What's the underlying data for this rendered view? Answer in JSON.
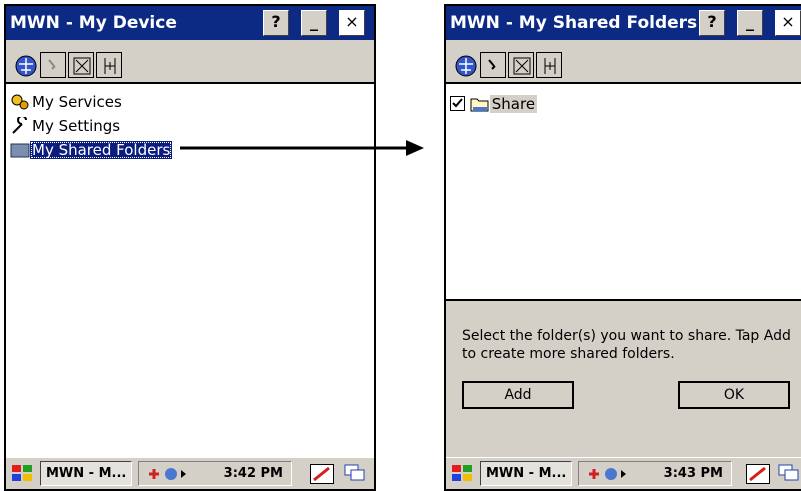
{
  "left_window": {
    "title": "MWN - My Device",
    "help_label": "?",
    "minimize_label": "_",
    "close_label": "×",
    "items": [
      {
        "label": "My Services",
        "icon": "services-gear-icon"
      },
      {
        "label": "My Settings",
        "icon": "wrench-icon"
      },
      {
        "label": "My Shared Folders",
        "icon": "shared-folders-icon",
        "selected": true
      }
    ],
    "taskbar": {
      "task_label": "MWN - M...",
      "clock": "3:42 PM"
    }
  },
  "right_window": {
    "title": "MWN - My Shared Folders",
    "help_label": "?",
    "minimize_label": "_",
    "close_label": "×",
    "items": [
      {
        "label": "Share",
        "checked": true,
        "icon": "shared-folder-icon"
      }
    ],
    "message": "Select the folder(s) you want to share.  Tap Add to create more shared folders.",
    "add_label": "Add",
    "ok_label": "OK",
    "taskbar": {
      "task_label": "MWN - M...",
      "clock": "3:43 PM"
    }
  },
  "colors": {
    "titlebar": "#0c2a84",
    "selection": "#0a1c7e",
    "chrome": "#d4d0c8"
  }
}
